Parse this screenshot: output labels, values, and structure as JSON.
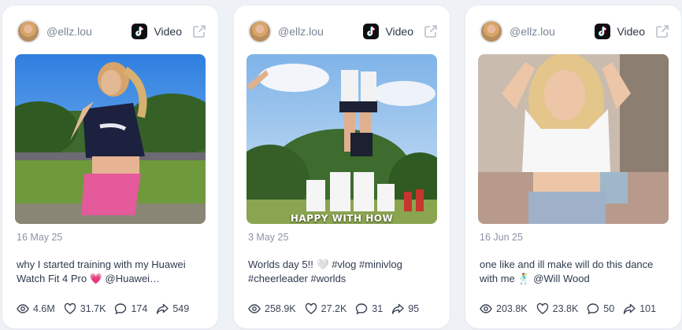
{
  "posts": [
    {
      "handle": "@ellz.lou",
      "type_label": "Video",
      "overlay_text": "",
      "date": "16 May 25",
      "description": "why I started training with my Huawei Watch Fit 4 Pro 💗 @Huawei…",
      "stats": {
        "views": "4.6M",
        "likes": "31.7K",
        "comments": "174",
        "shares": "549"
      }
    },
    {
      "handle": "@ellz.lou",
      "type_label": "Video",
      "overlay_text": "HAPPY WITH HOW",
      "date": "3 May 25",
      "description": "Worlds day 5!! 🤍 #vlog #minivlog #cheerleader #worlds",
      "stats": {
        "views": "258.9K",
        "likes": "27.2K",
        "comments": "31",
        "shares": "95"
      }
    },
    {
      "handle": "@ellz.lou",
      "type_label": "Video",
      "overlay_text": "",
      "date": "16 Jun 25",
      "description": "one like and ill make will do this dance with me 🕺 @Will Wood",
      "stats": {
        "views": "203.8K",
        "likes": "23.8K",
        "comments": "50",
        "shares": "101"
      }
    }
  ],
  "icons": {
    "platform": "tiktok-icon",
    "external": "external-link-icon",
    "views": "eye-icon",
    "likes": "heart-icon",
    "comments": "comment-icon",
    "shares": "share-icon"
  },
  "colors": {
    "background": "#eef1f6",
    "card": "#ffffff",
    "muted": "#8a93a6",
    "text": "#2f3a4f"
  }
}
